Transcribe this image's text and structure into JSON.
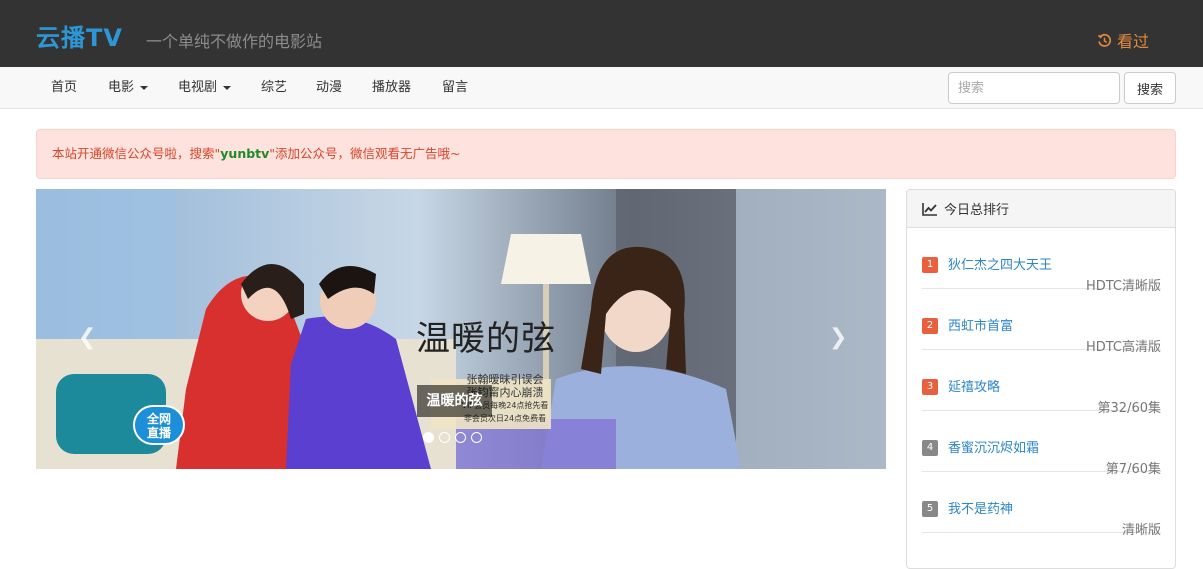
{
  "header": {
    "brand": "云播TV",
    "tagline": "一个单纯不做作的电影站",
    "watched_label": "看过"
  },
  "nav": {
    "items": [
      "首页",
      "电影",
      "电视剧",
      "综艺",
      "动漫",
      "播放器",
      "留言"
    ],
    "search_placeholder": "搜索",
    "search_button": "搜索"
  },
  "notice": {
    "before": "本站开通微信公众号啦，搜索\"",
    "keyword": "yunbtv",
    "after": "\"添加公众号，微信观看无广告哦~"
  },
  "carousel": {
    "poster_title": "温暖的弦",
    "poster_subtitle_1": "张翰暧昧引误会",
    "poster_subtitle_2": "张钧甯内心崩溃",
    "poster_note_1": "VIP会员每晚24点抢先看",
    "poster_note_2": "非会员次日24点免费看",
    "live_badge_1": "全网",
    "live_badge_2": "直播",
    "caption": "温暖的弦",
    "slide_count": 4,
    "active_index": 0
  },
  "ranking": {
    "title": "今日总排行",
    "items": [
      {
        "rank": "1",
        "title": "狄仁杰之四大天王",
        "status": "HDTC清晰版",
        "color": "#e9603f"
      },
      {
        "rank": "2",
        "title": "西虹市首富",
        "status": "HDTC高清版",
        "color": "#e9603f"
      },
      {
        "rank": "3",
        "title": "延禧攻略",
        "status": "第32/60集",
        "color": "#e9603f"
      },
      {
        "rank": "4",
        "title": "香蜜沉沉烬如霜",
        "status": "第7/60集",
        "color": "#888888"
      },
      {
        "rank": "5",
        "title": "我不是药神",
        "status": "清晰版",
        "color": "#888888"
      }
    ]
  }
}
